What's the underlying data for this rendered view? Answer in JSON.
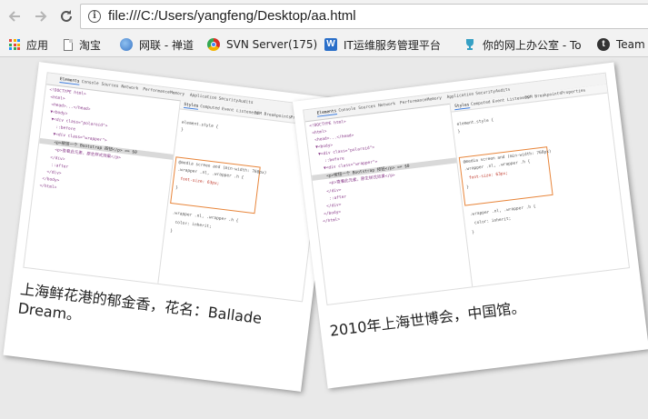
{
  "browser": {
    "back_icon": "arrow-left-icon",
    "forward_icon": "arrow-right-icon",
    "reload_icon": "reload-icon",
    "url": "file:///C:/Users/yangfeng/Desktop/aa.html",
    "bookmarks": [
      {
        "label": "应用",
        "icon": "apps-grid-icon",
        "color": "#e8453c"
      },
      {
        "label": "淘宝",
        "icon": "page-icon",
        "color": "#777777"
      },
      {
        "label": "网联 - 禅道",
        "icon": "globe-icon",
        "color": "#3b77c6"
      },
      {
        "label": "SVN Server(175)",
        "icon": "chrome-icon",
        "color": "#d93025"
      },
      {
        "label": "IT运维服务管理平台",
        "icon": "w-logo-icon",
        "color": "#2a6fc9"
      },
      {
        "label": "你的网上办公室 - To",
        "icon": "trophy-icon",
        "color": "#36a0c4"
      },
      {
        "label": "Team",
        "icon": "t-logo-icon",
        "color": "#333333"
      }
    ]
  },
  "polaroids": [
    {
      "caption": "上海鲜花港的郁金香，花名：Ballade Dream。",
      "devtools_tabs": [
        "Elements",
        "Console",
        "Sources",
        "Network",
        "Performance",
        "Memory",
        "Application",
        "Security",
        "Audits"
      ],
      "styles_tabs": [
        "Styles",
        "Computed",
        "Event Listeners",
        "DOM Breakpoints",
        "Properties"
      ],
      "dom_lines": [
        "<!DOCTYPE html>",
        "<html>",
        "<head>...</head>",
        "▼<body>",
        "▼<div class=\"polaroid\">",
        "::before",
        "▼<div class=\"wrapper\">",
        "<p>按钮一个 Bootstrap 按钮</p> == $0",
        "<p>查看此元素，原生样式效果</p>",
        "</div>",
        "::after",
        "</div>",
        "</body>",
        "</html>"
      ],
      "style_lines": [
        "element.style {",
        "}",
        "@media screen and (min-width: 768px)",
        ".wrapper .nl, .wrapper .h {",
        "font-size: 63px;",
        "}",
        ".wrapper .nl, .wrapper .h {",
        "color: inherit;",
        "}"
      ]
    },
    {
      "caption": "2010年上海世博会，中国馆。",
      "devtools_tabs": [
        "Elements",
        "Console",
        "Sources",
        "Network",
        "Performance",
        "Memory",
        "Application",
        "Security",
        "Audits"
      ],
      "styles_tabs": [
        "Styles",
        "Computed",
        "Event Listeners",
        "DOM Breakpoints",
        "Properties"
      ],
      "dom_lines": [
        "<!DOCTYPE html>",
        "<html>",
        "<head>...</head>",
        "▼<body>",
        "▼<div class=\"polaroid\">",
        "::before",
        "▼<div class=\"wrapper\">",
        "<p>按钮一个 Bootstrap 按钮</p> == $0",
        "<p>查看此元素，原生样式效果</p>",
        "</div>",
        "::after",
        "</div>",
        "</body>",
        "</html>"
      ],
      "style_lines": [
        "element.style {",
        "}",
        "@media screen and (min-width: 768px)",
        ".wrapper .nl, .wrapper .h {",
        "font-size: 63px;",
        "}",
        ".wrapper .nl, .wrapper .h {",
        "color: inherit;",
        "}"
      ]
    }
  ]
}
